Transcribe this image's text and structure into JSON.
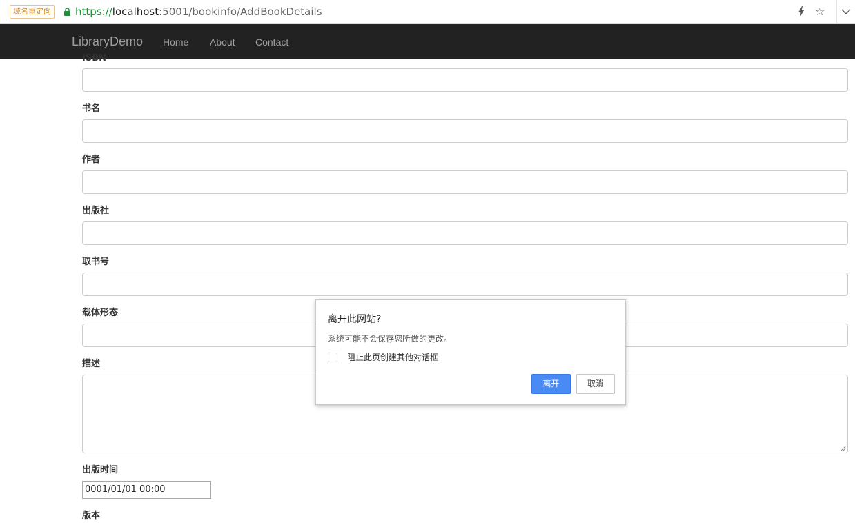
{
  "browser": {
    "redirect_badge": "域名重定向",
    "url_protocol": "https://",
    "url_host": "localhost",
    "url_rest": ":5001/bookinfo/AddBookDetails",
    "icons": [
      "lock-icon",
      "lightning-icon",
      "star-icon",
      "chevron-down-icon"
    ]
  },
  "navbar": {
    "brand": "LibraryDemo",
    "links": [
      "Home",
      "About",
      "Contact"
    ]
  },
  "form": {
    "labels": [
      "ISBN",
      "书名",
      "作者",
      "出版社",
      "取书号",
      "载体形态",
      "描述",
      "出版时间",
      "版本"
    ],
    "publish_date_value": "0001/01/01 00:00"
  },
  "dialog": {
    "title": "离开此网站?",
    "message": "系统可能不会保存您所做的更改。",
    "checkbox_label": "阻止此页创建其他对话框",
    "leave_button": "离开",
    "cancel_button": "取消"
  },
  "colors": {
    "navbar_bg": "#222222",
    "nav_text": "#9d9d9d",
    "url_secure": "#1f8f3a",
    "primary_button": "#4a8af4"
  }
}
